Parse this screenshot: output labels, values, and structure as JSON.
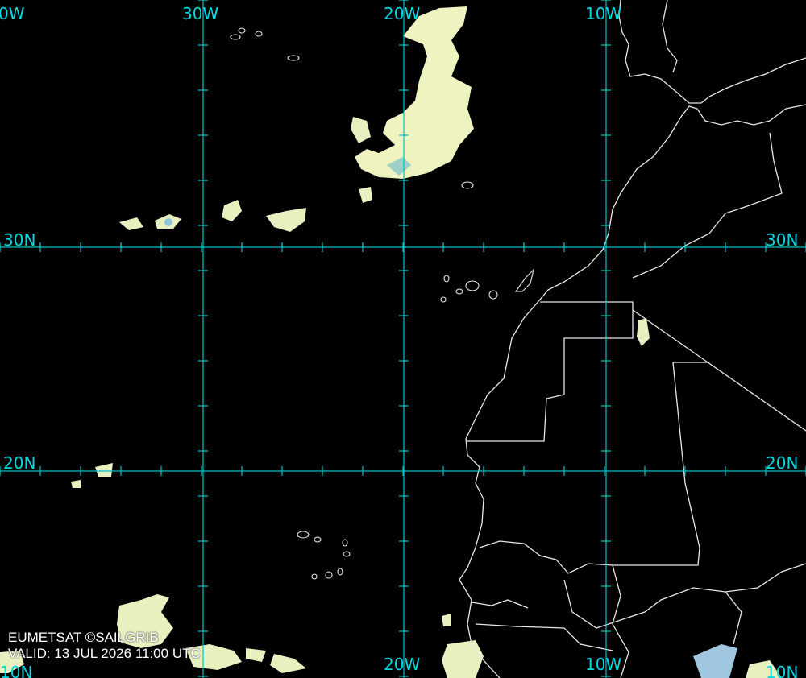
{
  "map": {
    "lon_labels_top": [
      "30W",
      "20W",
      "10W"
    ],
    "lon_labels_bottom": [
      "20W",
      "10W"
    ],
    "lat_labels_left": [
      "30N",
      "20N"
    ],
    "lat_labels_right": [
      "30N",
      "20N"
    ],
    "edge_label_top_left": "0W",
    "edge_label_bottom_left": "10N",
    "edge_label_bottom_right": "10N",
    "colors": {
      "background": "#000000",
      "grid": "#00c8d0",
      "coastline": "#e8e8e8",
      "cloud_light": "#f2f5c4",
      "cloud_mid": "#c8e8b0",
      "cloud_blue": "#7fbfd8"
    }
  },
  "credit": {
    "source": "EUMETSAT ©SAILGRIB",
    "valid": "VALID:  13 JUL 2026 11:00 UTC"
  }
}
